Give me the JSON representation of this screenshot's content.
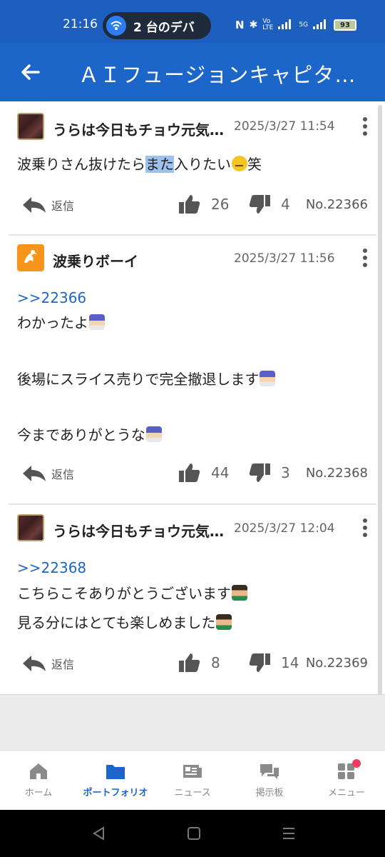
{
  "status_bar": {
    "time": "21:16",
    "pill_text": "2 台のデバ",
    "network": "5G",
    "battery": "93"
  },
  "header": {
    "title": "ＡＩフュージョンキャピタルグループ"
  },
  "posts": [
    {
      "username": "うらは今日もチョウ元気です",
      "date": "2025/3/27 11:54",
      "text_before": "波乗りさん抜けたら",
      "text_highlight": "また",
      "text_after": "入りたい",
      "text_tail": "笑",
      "reply_label": "返信",
      "likes": "26",
      "dislikes": "4",
      "number": "No.22366"
    },
    {
      "username": "波乗りボーイ",
      "date": "2025/3/27 11:56",
      "reply_link": ">>22366",
      "line1": "わかったよ",
      "line2": "後場にスライス売りで完全撤退します",
      "line3": "今までありがとうな",
      "reply_label": "返信",
      "likes": "44",
      "dislikes": "3",
      "number": "No.22368"
    },
    {
      "username": "うらは今日もチョウ元気です",
      "date": "2025/3/27 12:04",
      "reply_link": ">>22368",
      "line1": "こちらこそありがとうございます",
      "line2": "見る分にはとても楽しめました",
      "reply_label": "返信",
      "likes": "8",
      "dislikes": "14",
      "number": "No.22369"
    }
  ],
  "bottom_nav": {
    "items": [
      {
        "label": "ホーム",
        "icon": "home-icon"
      },
      {
        "label": "ポートフォリオ",
        "icon": "folder-icon"
      },
      {
        "label": "ニュース",
        "icon": "news-icon"
      },
      {
        "label": "掲示板",
        "icon": "chat-icon"
      },
      {
        "label": "メニュー",
        "icon": "menu-grid-icon"
      }
    ],
    "active_index": 1
  },
  "colors": {
    "brand_blue": "#1d66c9",
    "status_blue": "#1d5fbf",
    "notification_dot": "#f03a5f"
  }
}
